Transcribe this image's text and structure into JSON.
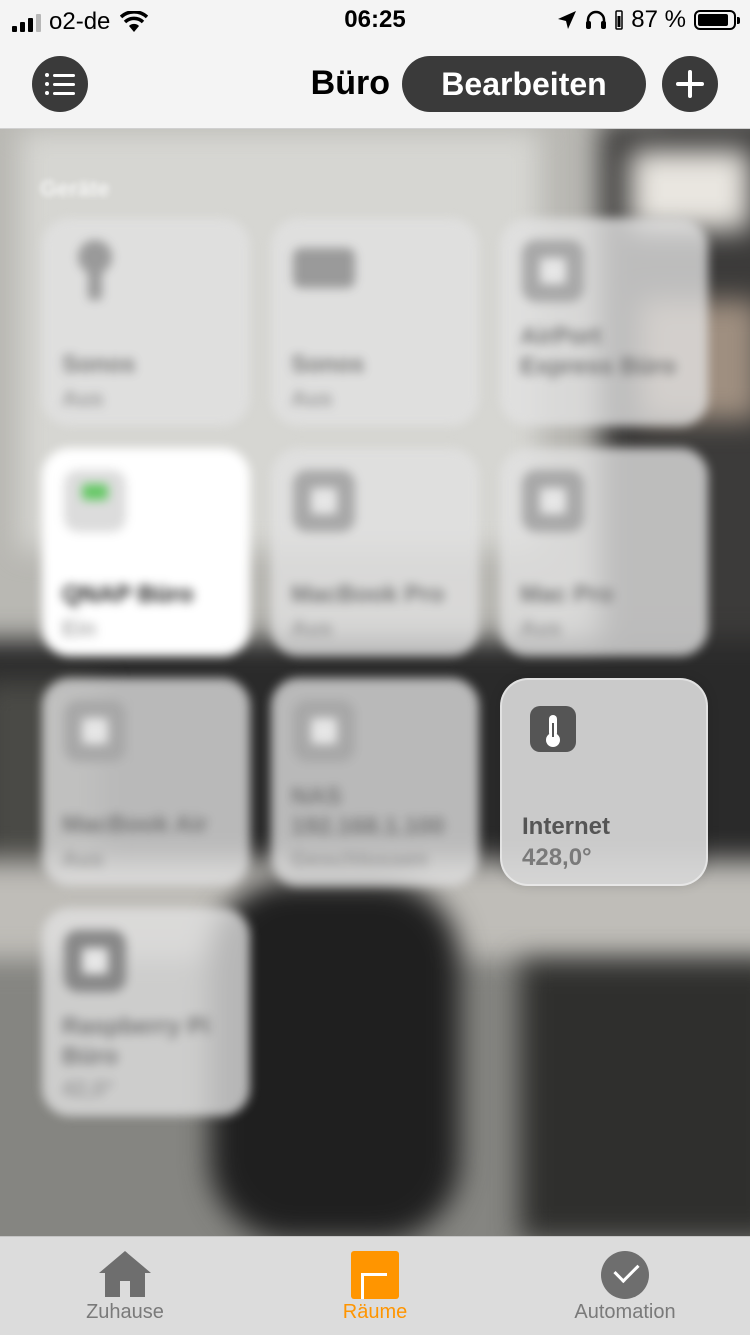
{
  "status_bar": {
    "carrier": "o2-de",
    "time": "06:25",
    "battery_text": "87 %",
    "battery_level": 0.87
  },
  "header": {
    "room_title": "Büro",
    "edit_label": "Bearbeiten"
  },
  "section": {
    "title": "Geräte"
  },
  "tiles": [
    {
      "name": "Sonos",
      "state": "Aus",
      "icon": "bulb-icon"
    },
    {
      "name": "Sonos",
      "state": "Aus",
      "icon": "speaker-icon"
    },
    {
      "name": "AirPort Express Büro",
      "state": "",
      "icon": "airport-icon"
    },
    {
      "name": "QNAP Büro",
      "state": "Ein",
      "icon": "nas-icon"
    },
    {
      "name": "MacBook Pro",
      "state": "Aus",
      "icon": "computer-icon"
    },
    {
      "name": "Mac Pro",
      "state": "Aus",
      "icon": "computer-icon"
    },
    {
      "name": "MacBook Air",
      "state": "Aus",
      "icon": "computer-icon"
    },
    {
      "name": "NAS 192.168.1.100",
      "state": "Geschlossen",
      "icon": "network-icon"
    },
    {
      "name": "Internet",
      "state": "428,0°",
      "icon": "thermometer-icon"
    },
    {
      "name": "Raspberry Pi Büro",
      "state": "42,0°",
      "icon": "sensor-icon"
    }
  ],
  "tabbar": {
    "home_label": "Zuhause",
    "rooms_label": "Räume",
    "automation_label": "Automation",
    "active": "rooms"
  },
  "colors": {
    "accent": "#ff9500",
    "button_dark": "#3a3a3a"
  }
}
